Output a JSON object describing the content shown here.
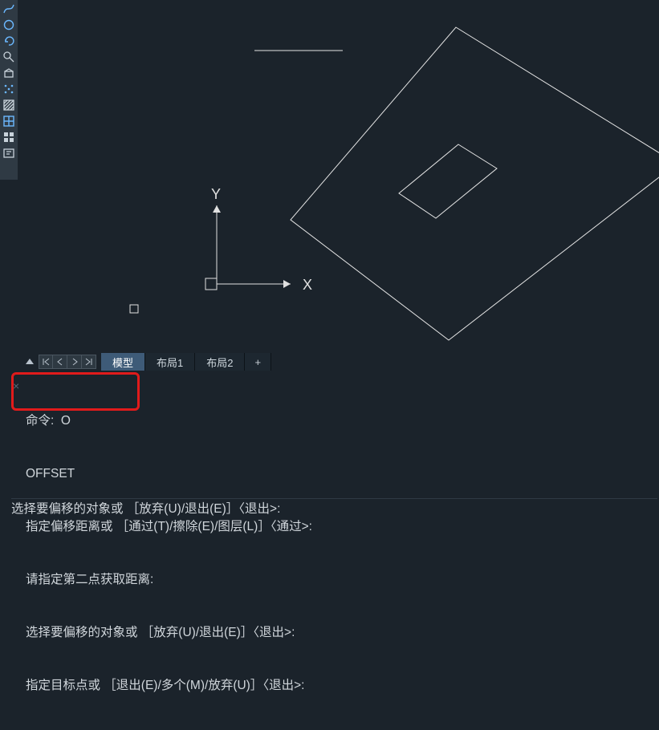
{
  "toolbar": {
    "items": [
      {
        "name": "spline-icon"
      },
      {
        "name": "circle-icon"
      },
      {
        "name": "redo-icon"
      },
      {
        "name": "magnify-icon"
      },
      {
        "name": "select-icon"
      },
      {
        "name": "points-icon"
      },
      {
        "name": "hatch-icon"
      },
      {
        "name": "grid-icon"
      },
      {
        "name": "square-grid-icon"
      },
      {
        "name": "text-box-icon"
      }
    ]
  },
  "tabs": {
    "active": "模型",
    "items": [
      "模型",
      "布局1",
      "布局2"
    ],
    "add": "+"
  },
  "command": {
    "close": "×",
    "history": [
      "命令:  O",
      "OFFSET",
      "指定偏移距离或 ［通过(T)/擦除(E)/图层(L)］〈通过>:",
      "请指定第二点获取距离:",
      "选择要偏移的对象或 ［放弃(U)/退出(E)］〈退出>:",
      "指定目标点或 ［退出(E)/多个(M)/放弃(U)］〈退出>:"
    ],
    "prompt": "选择要偏移的对象或 ［放弃(U)/退出(E)］〈退出>: ",
    "input": ""
  },
  "axes": {
    "x": "X",
    "y": "Y"
  },
  "colors": {
    "bg": "#1b232b",
    "toolbar": "#2f3a44",
    "highlight": "#e11b1b",
    "tabActive": "#3e5b78",
    "iconBlue": "#6bb8ff"
  }
}
